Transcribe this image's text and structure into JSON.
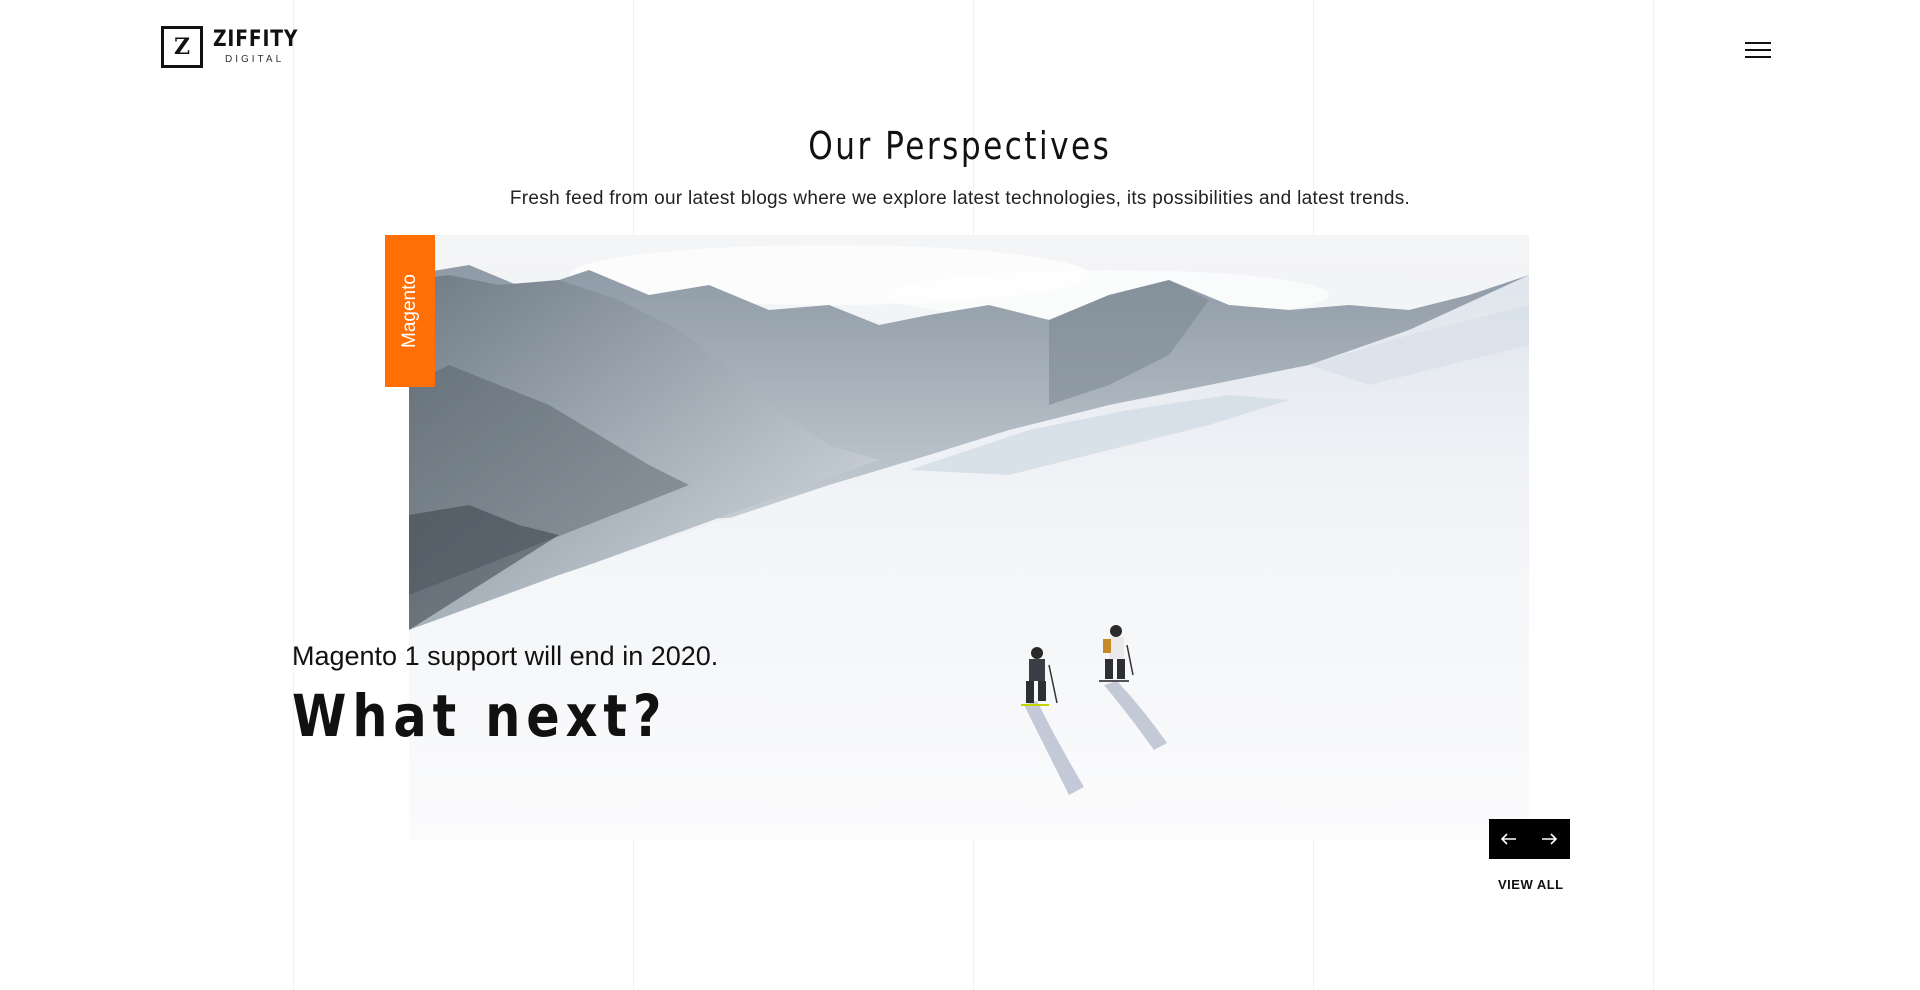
{
  "header": {
    "logo_mark": "Z",
    "logo_name": "ZIFFITY",
    "logo_sub": "DIGITAL"
  },
  "section": {
    "title": "Our Perspectives",
    "subtitle": "Fresh feed from our latest blogs where we explore latest technologies, its possibilities and latest trends."
  },
  "featured_post": {
    "category": "Magento",
    "kicker": "Magento 1 support will end in 2020.",
    "title": "What next?"
  },
  "slider": {
    "prev_icon": "arrow-left-icon",
    "next_icon": "arrow-right-icon"
  },
  "view_all_label": "VIEW ALL",
  "colors": {
    "accent": "#ff6f06",
    "text": "#111111",
    "background": "#ffffff"
  }
}
